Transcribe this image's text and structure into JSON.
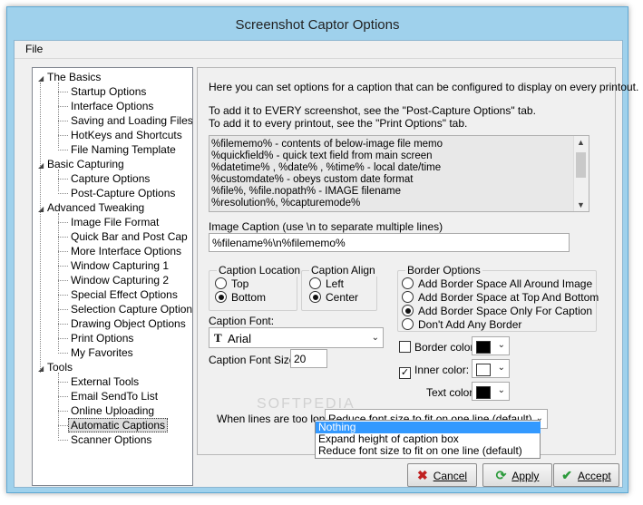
{
  "window": {
    "title": "Screenshot Captor Options"
  },
  "menu": {
    "file": "File"
  },
  "tree": [
    {
      "label": "The Basics",
      "children": [
        "Startup Options",
        "Interface Options",
        "Saving and Loading Files",
        "HotKeys and Shortcuts",
        "File Naming Template"
      ]
    },
    {
      "label": "Basic Capturing",
      "children": [
        "Capture Options",
        "Post-Capture Options"
      ]
    },
    {
      "label": "Advanced Tweaking",
      "children": [
        "Image File Format",
        "Quick Bar and Post Cap",
        "More Interface Options",
        "Window Capturing 1",
        "Window Capturing 2",
        "Special Effect Options",
        "Selection Capture Options",
        "Drawing Object Options",
        "Print Options",
        "My Favorites"
      ]
    },
    {
      "label": "Tools",
      "children": [
        "External Tools",
        "Email SendTo List",
        "Online Uploading",
        "Automatic Captions",
        "Scanner Options"
      ]
    }
  ],
  "selected_item": "Automatic Captions",
  "panel": {
    "intro": "Here you can set options for a caption that can be configured to display on every printout.",
    "note1": "To add it to EVERY screenshot, see the \"Post-Capture Options\" tab.",
    "note2": "To add it to every printout, see the \"Print Options\" tab.",
    "memo_lines": [
      "%filememo% - contents of below-image file memo",
      "%quickfield% - quick text field from main screen",
      "%datetime% , %date% , %time% - local date/time",
      "%customdate% - obeys custom date format",
      "%file%, %file.nopath% - IMAGE filename",
      "%resolution%, %capturemode%"
    ],
    "image_caption_label": "Image Caption (use \\n to separate multiple lines)",
    "image_caption_value": "%filename%\\n%filememo%",
    "caption_location": {
      "title": "Caption Location",
      "options": [
        "Top",
        "Bottom"
      ],
      "selected": "Bottom"
    },
    "caption_align": {
      "title": "Caption Align",
      "options": [
        "Left",
        "Center"
      ],
      "selected": "Center"
    },
    "border_options": {
      "title": "Border Options",
      "options": [
        "Add Border Space All Around Image",
        "Add Border Space at Top And Bottom",
        "Add Border Space Only For Caption",
        "Don't Add Any Border"
      ],
      "selected": "Add Border Space Only For Caption"
    },
    "caption_font_label": "Caption Font:",
    "caption_font_value": "Arial",
    "caption_font_size_label": "Caption Font Size",
    "caption_font_size_value": "20",
    "border_color": {
      "label": "Border color:",
      "checked": false,
      "color": "#000000"
    },
    "inner_color": {
      "label": "Inner color:",
      "checked": true,
      "color": "#ffffff"
    },
    "text_color": {
      "label": "Text color:",
      "color": "#000000"
    },
    "lines_too_long_label": "When lines are too long:",
    "lines_too_long_value": "Reduce font size to fit on one line (default)",
    "lines_too_long_options": [
      "Nothing",
      "Expand height of caption box",
      "Reduce font size to fit on one line (default)"
    ],
    "highlighted_option": "Nothing"
  },
  "buttons": {
    "cancel": "Cancel",
    "apply": "Apply",
    "accept": "Accept"
  },
  "watermark": "SOFTPEDIA"
}
